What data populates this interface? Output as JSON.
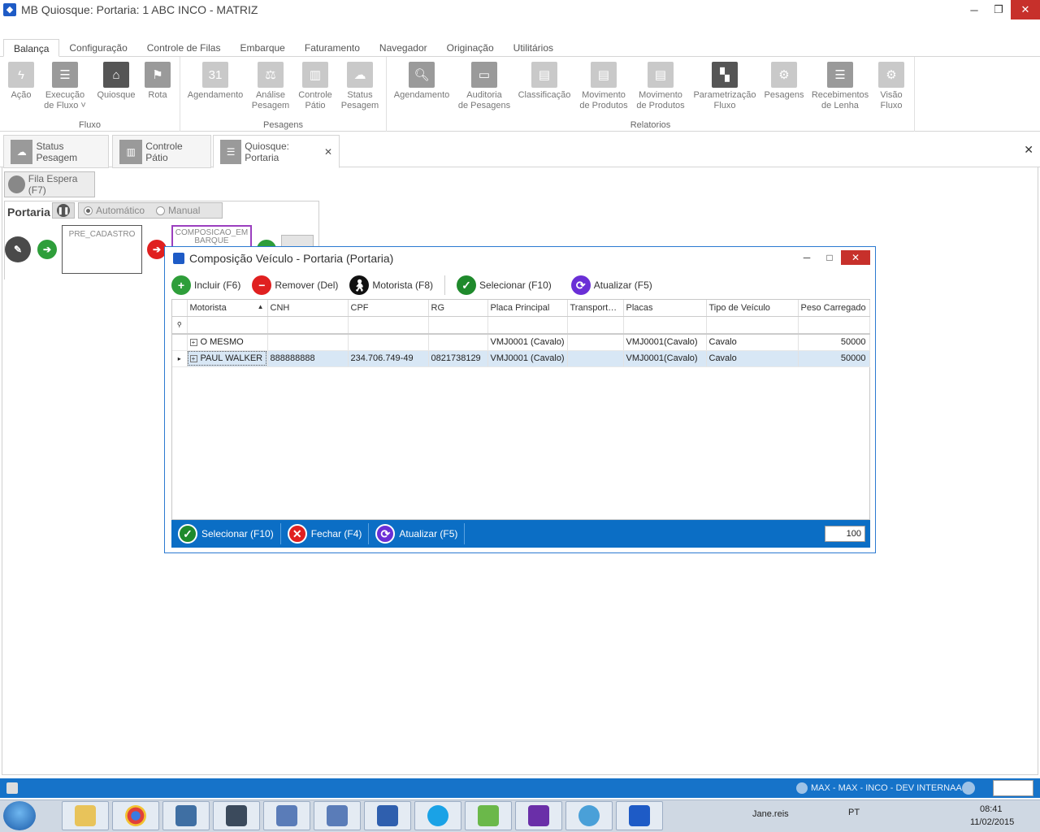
{
  "window": {
    "title": "MB Quiosque: Portaria: 1 ABC INCO - MATRIZ"
  },
  "ribbon_tabs": [
    "Balança",
    "Configuração",
    "Controle de Filas",
    "Embarque",
    "Faturamento",
    "Navegador",
    "Originação",
    "Utilitários"
  ],
  "ribbon": {
    "groups": [
      {
        "label": "Fluxo",
        "buttons": [
          {
            "l1": "Ação",
            "l2": ""
          },
          {
            "l1": "Execução",
            "l2": "de Fluxo ˅"
          },
          {
            "l1": "Quiosque",
            "l2": ""
          },
          {
            "l1": "Rota",
            "l2": ""
          }
        ]
      },
      {
        "label": "Pesagens",
        "buttons": [
          {
            "l1": "Agendamento",
            "l2": ""
          },
          {
            "l1": "Análise",
            "l2": "Pesagem"
          },
          {
            "l1": "Controle",
            "l2": "Pátio"
          },
          {
            "l1": "Status",
            "l2": "Pesagem"
          }
        ]
      },
      {
        "label": "Relatorios",
        "buttons": [
          {
            "l1": "Agendamento",
            "l2": ""
          },
          {
            "l1": "Auditoria",
            "l2": "de Pesagens"
          },
          {
            "l1": "Classificação",
            "l2": ""
          },
          {
            "l1": "Movimento",
            "l2": "de Produtos"
          },
          {
            "l1": "Movimento",
            "l2": "de Produtos"
          },
          {
            "l1": "Parametrização",
            "l2": "Fluxo"
          },
          {
            "l1": "Pesagens",
            "l2": ""
          },
          {
            "l1": "Recebimentos",
            "l2": "de Lenha"
          },
          {
            "l1": "Visão",
            "l2": "Fluxo"
          }
        ]
      }
    ]
  },
  "doc_tabs": [
    {
      "label": "Status Pesagem"
    },
    {
      "label": "Controle Pátio"
    },
    {
      "label": "Quiosque: Portaria"
    }
  ],
  "portaria": {
    "fila_label": "Fila Espera (F7)",
    "title": "Portaria",
    "mode_auto": "Automático",
    "mode_manual": "Manual",
    "stage1": "PRE_CADASTRO",
    "stage2": "COMPOSICAO_EM BARQUE"
  },
  "dialog": {
    "title": "Composição Veículo - Portaria (Portaria)",
    "toolbar": {
      "incluir": "Incluir (F6)",
      "remover": "Remover (Del)",
      "motorista": "Motorista (F8)",
      "selecionar": "Selecionar (F10)",
      "atualizar": "Atualizar (F5)"
    },
    "columns": [
      "Motorista",
      "CNH",
      "CPF",
      "RG",
      "Placa Principal",
      "Transport…",
      "Placas",
      "Tipo de Veículo",
      "Peso Carregado"
    ],
    "rows": [
      {
        "motorista": "O MESMO",
        "cnh": "",
        "cpf": "",
        "rg": "",
        "placa": "VMJ0001 (Cavalo)",
        "transport": "",
        "placas": "VMJ0001(Cavalo)",
        "tipo": "Cavalo",
        "peso": "50000"
      },
      {
        "motorista": "PAUL WALKER",
        "cnh": "888888888",
        "cpf": "234.706.749-49",
        "rg": "0821738129",
        "placa": "VMJ0001 (Cavalo)",
        "transport": "",
        "placas": "VMJ0001(Cavalo)",
        "tipo": "Cavalo",
        "peso": "50000"
      }
    ],
    "footer": {
      "selecionar": "Selecionar (F10)",
      "fechar": "Fechar (F4)",
      "atualizar": "Atualizar (F5)",
      "page_size": "100"
    }
  },
  "statusbar": {
    "user": "MAX - MAX - INCO - DEV INTERNAA"
  },
  "taskbar": {
    "tray_user": "Jane.reis",
    "lang": "PT",
    "time": "08:41",
    "date": "11/02/2015"
  },
  "colors": {
    "accent": "#0b6ec5",
    "green": "#2e9e3a",
    "red": "#e02020",
    "purple": "#6a2fd6",
    "selected_row": "#d8e7f5"
  }
}
